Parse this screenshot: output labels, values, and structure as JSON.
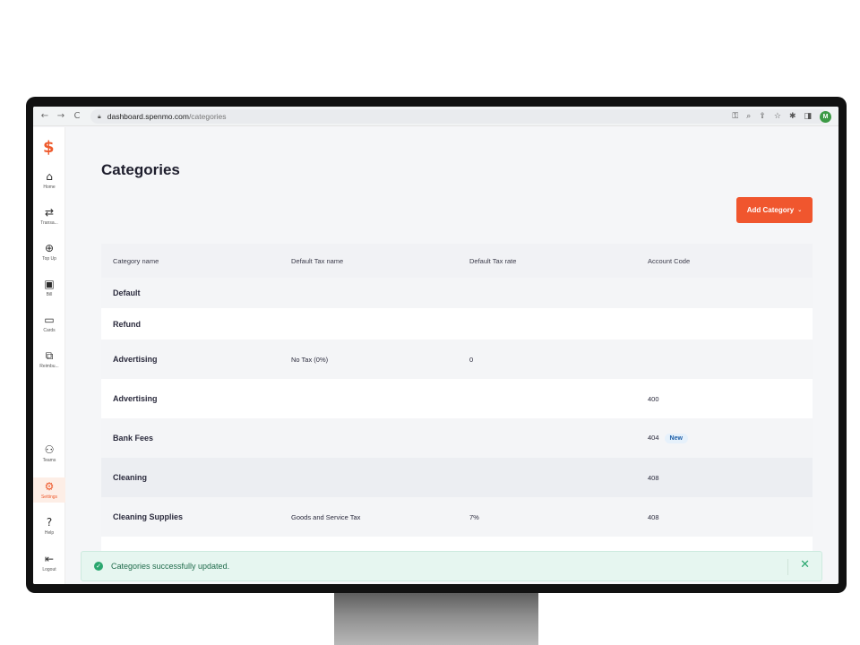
{
  "browser": {
    "nav": {
      "back": "←",
      "forward": "→",
      "reload": "C"
    },
    "url_host": "dashboard.spenmo.com",
    "url_path": "/categories",
    "toolbar_icons": [
      "key-icon",
      "zoom-icon",
      "share-icon",
      "star-icon",
      "extensions-icon",
      "sidepanel-icon"
    ],
    "profile_initial": "M"
  },
  "sidebar": {
    "logo": "$",
    "items": [
      {
        "label": "Home",
        "icon": "⌂"
      },
      {
        "label": "Transa...",
        "icon": "⇄"
      },
      {
        "label": "Top Up",
        "icon": "⊕"
      },
      {
        "label": "Bill",
        "icon": "▣"
      },
      {
        "label": "Cards",
        "icon": "▭"
      },
      {
        "label": "Reimbu...",
        "icon": "⧉"
      }
    ],
    "bottom_items": [
      {
        "label": "Teams",
        "icon": "⚇"
      },
      {
        "label": "Settings",
        "icon": "⚙"
      },
      {
        "label": "Help",
        "icon": "?"
      },
      {
        "label": "Logout",
        "icon": "⇤"
      }
    ]
  },
  "page": {
    "title": "Categories",
    "add_button": "Add Category",
    "add_button_chevron": "⌄"
  },
  "table": {
    "headers": [
      "Category name",
      "Default Tax name",
      "Default Tax rate",
      "Account Code"
    ],
    "rows": [
      {
        "name": "Default",
        "tax_name": "",
        "tax_rate": "",
        "code": "",
        "badge": ""
      },
      {
        "name": "Refund",
        "tax_name": "",
        "tax_rate": "",
        "code": "",
        "badge": ""
      },
      {
        "name": "Advertising",
        "tax_name": "No Tax (0%)",
        "tax_rate": "0",
        "code": "",
        "badge": ""
      },
      {
        "name": "Advertising",
        "tax_name": "",
        "tax_rate": "",
        "code": "400",
        "badge": ""
      },
      {
        "name": "Bank Fees",
        "tax_name": "",
        "tax_rate": "",
        "code": "404",
        "badge": "New"
      },
      {
        "name": "Cleaning",
        "tax_name": "",
        "tax_rate": "",
        "code": "408",
        "badge": ""
      },
      {
        "name": "Cleaning Supplies",
        "tax_name": "Goods and Service Tax",
        "tax_rate": "7%",
        "code": "408",
        "badge": ""
      }
    ]
  },
  "toast": {
    "message": "Categories successfully updated.",
    "status_color": "#2aa76f"
  },
  "colors": {
    "accent": "#f0562e",
    "success": "#2aa76f"
  }
}
